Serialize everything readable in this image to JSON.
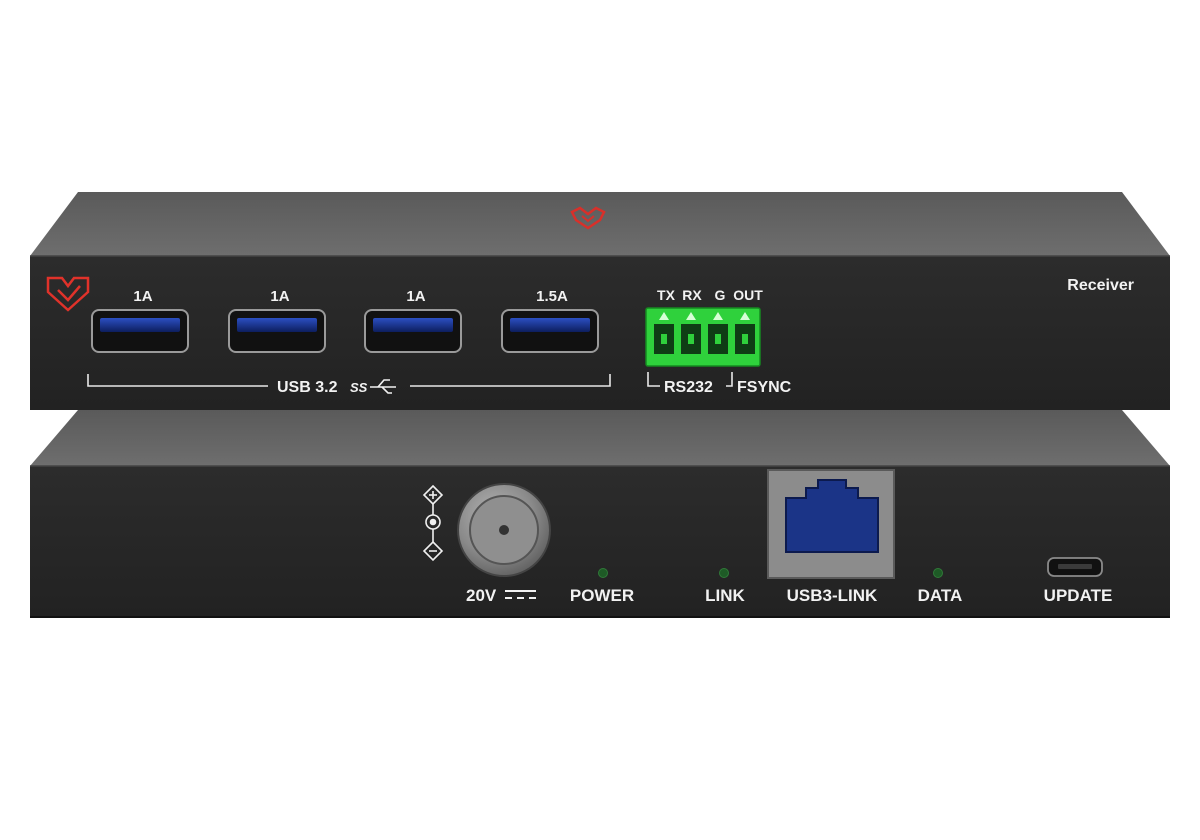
{
  "front_panel": {
    "device_label": "Receiver",
    "usb_ports": [
      {
        "current": "1A"
      },
      {
        "current": "1A"
      },
      {
        "current": "1A"
      },
      {
        "current": "1.5A"
      }
    ],
    "usb_group_label": "USB 3.2",
    "usb_logo_text": "SS",
    "terminal_pin_labels": [
      "TX",
      "RX",
      "G",
      "OUT"
    ],
    "rs232_label": "RS232",
    "fsync_label": "FSYNC",
    "terminal_color": "#2fd13c",
    "usb_port_color": "#1a3a9e",
    "logo_color": "#e0322a"
  },
  "rear_panel": {
    "power_input_label": "20V",
    "power_led_label": "POWER",
    "link_led_label": "LINK",
    "rj45_label": "USB3-LINK",
    "data_led_label": "DATA",
    "update_label": "UPDATE",
    "rj45_color": "#1b3487",
    "led_color": "#1e5a26"
  }
}
